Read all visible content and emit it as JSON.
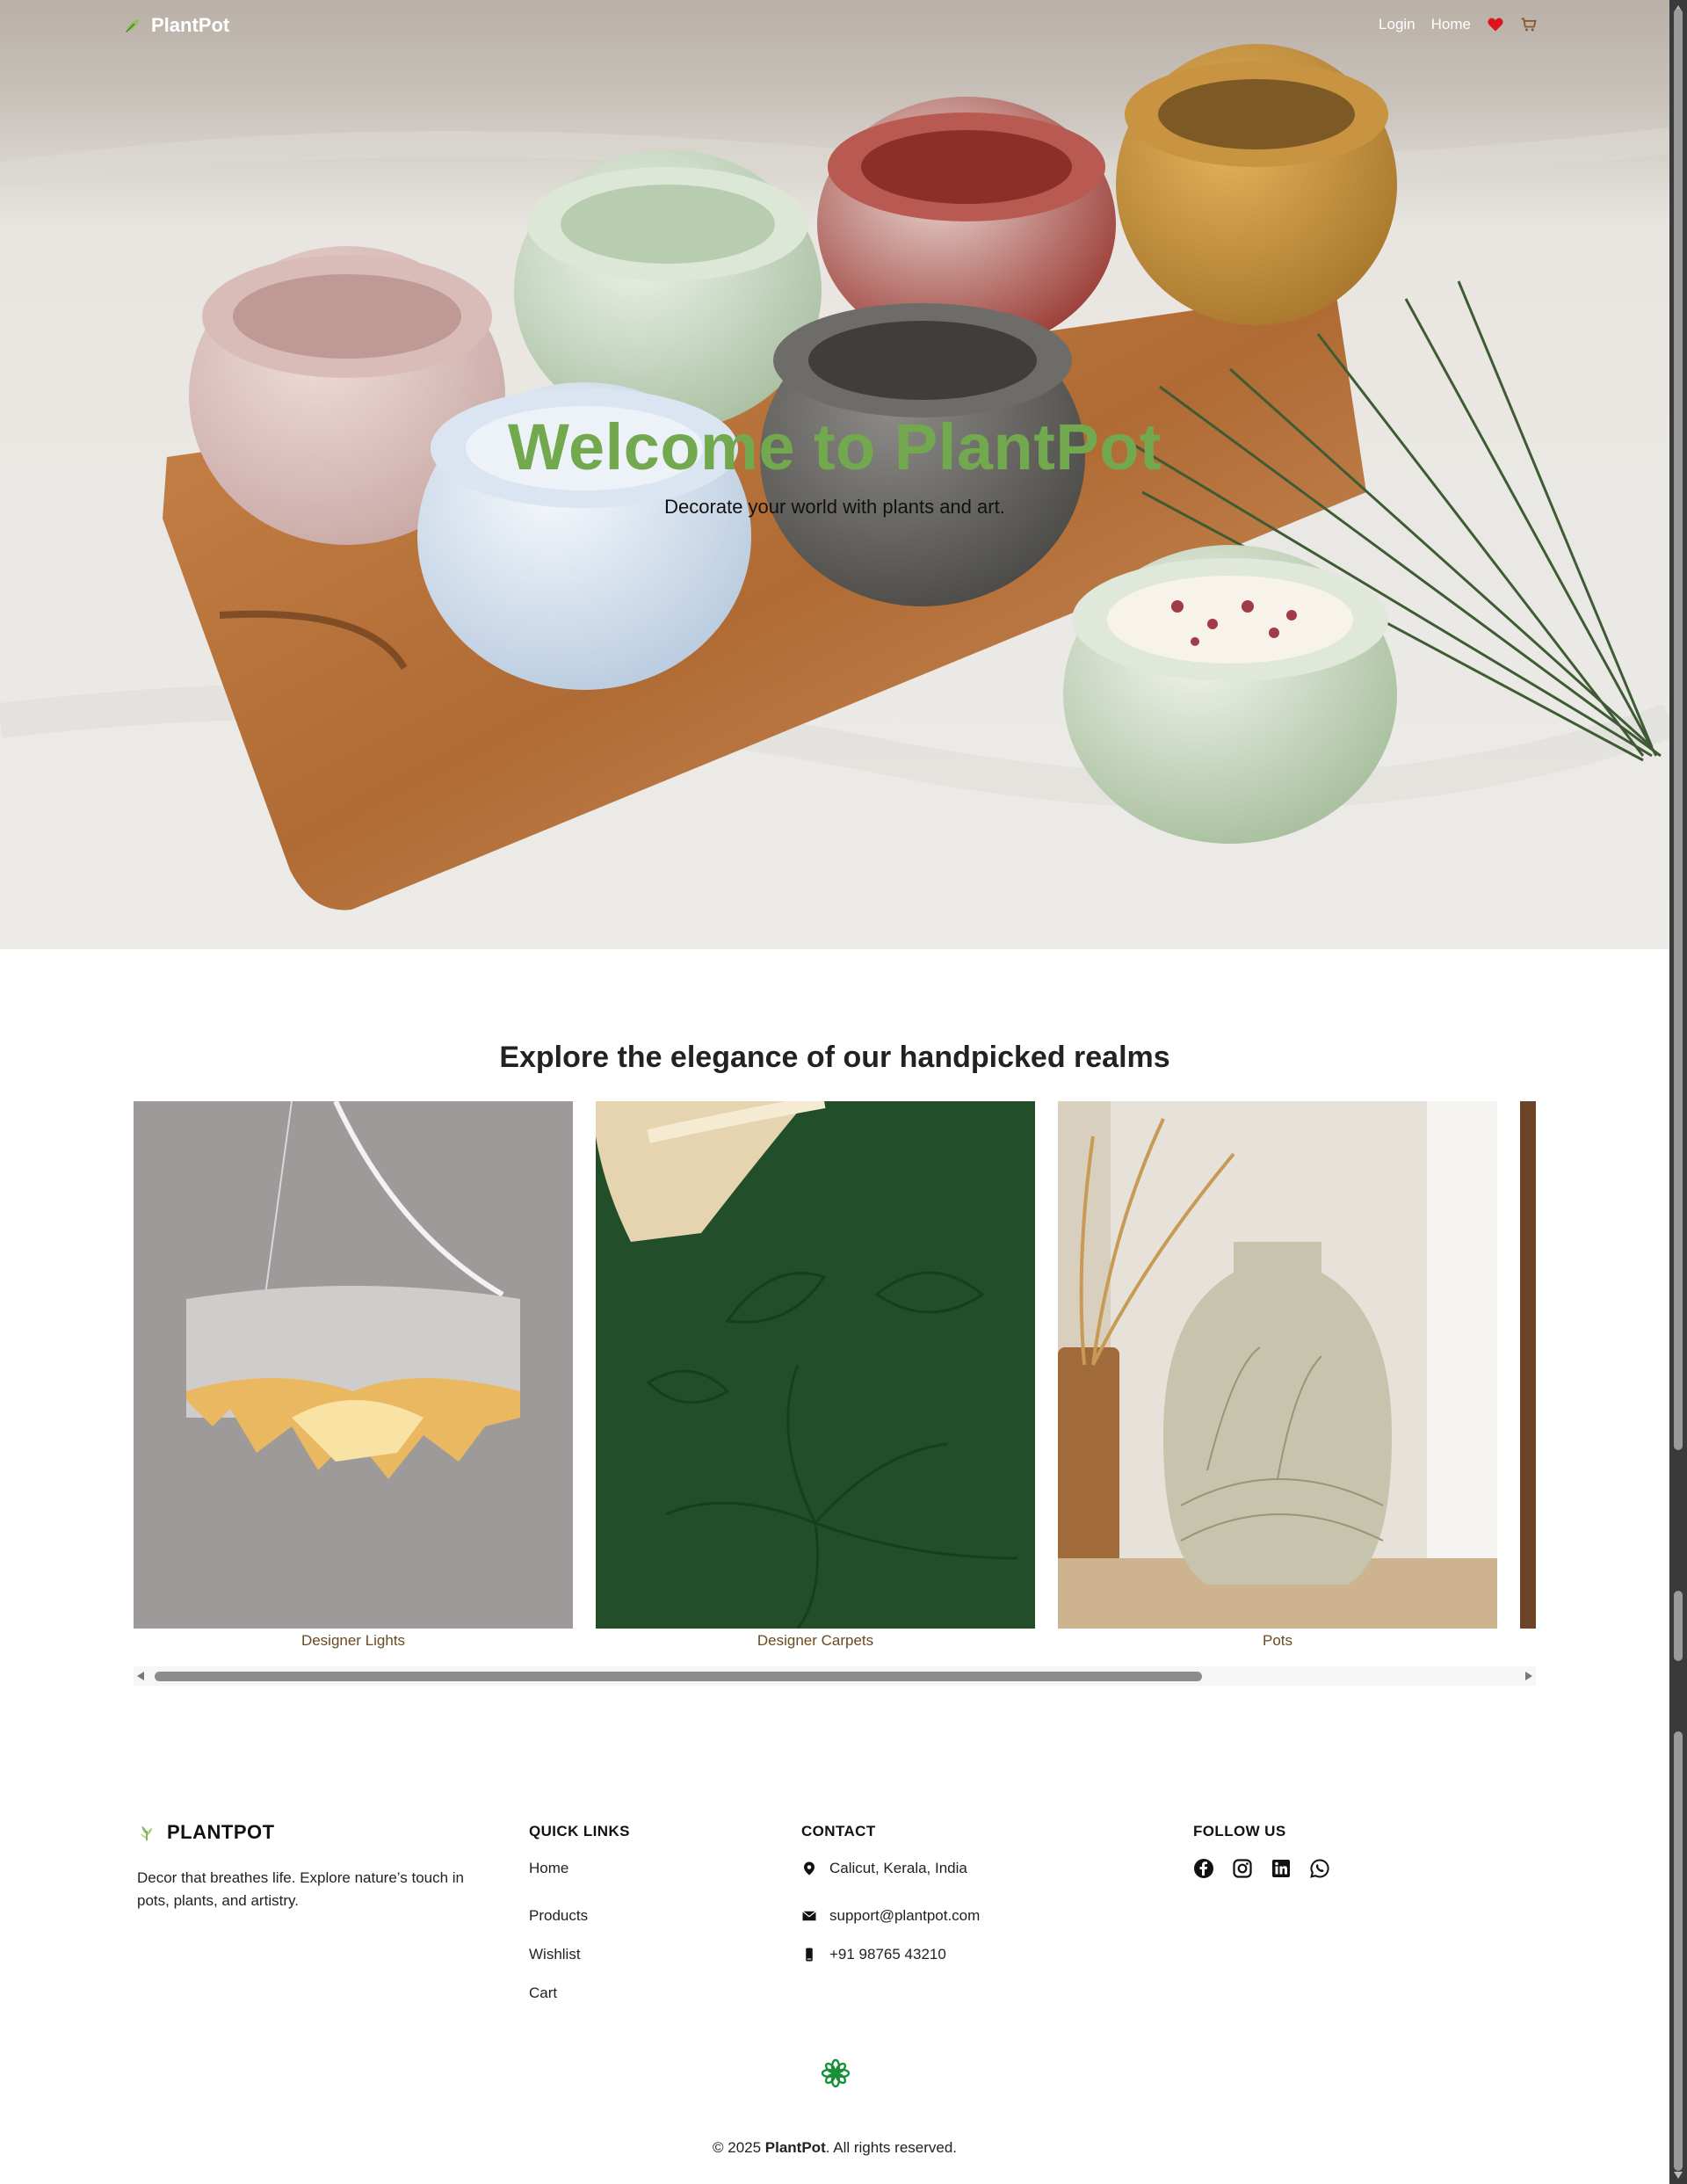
{
  "nav": {
    "brand": "PlantPot",
    "links": [
      "Login",
      "Home"
    ],
    "icons": [
      "heart-icon",
      "cart-icon"
    ],
    "heart_color": "#e0141e",
    "cart_color": "#8b5a2b"
  },
  "hero": {
    "title": "Welcome to PlantPot",
    "subtitle": "Decorate your world with plants and art.",
    "title_color": "#73a94e"
  },
  "realms": {
    "title": "Explore the elegance of our handpicked realms",
    "cards": [
      {
        "label": "Designer Lights"
      },
      {
        "label": "Designer Carpets"
      },
      {
        "label": "Pots"
      },
      {
        "label": ""
      }
    ]
  },
  "footer": {
    "brand": "PLANTPOT",
    "description": "Decor that breathes life. Explore nature’s touch in pots, plants, and artistry.",
    "quick_links": {
      "heading": "QUICK LINKS",
      "items": [
        "Home",
        "Products",
        "Wishlist",
        "Cart"
      ]
    },
    "contact": {
      "heading": "CONTACT",
      "items": [
        {
          "icon": "location-pin-icon",
          "text": "Calicut, Kerala, India"
        },
        {
          "icon": "envelope-icon",
          "text": "support@plantpot.com"
        },
        {
          "icon": "phone-icon",
          "text": "+91 98765 43210"
        }
      ]
    },
    "follow": {
      "heading": "FOLLOW US",
      "icons": [
        "facebook-icon",
        "instagram-icon",
        "linkedin-icon",
        "whatsapp-icon"
      ]
    },
    "copyright_prefix": "© 2025 ",
    "copyright_brand": "PlantPot",
    "copyright_suffix": ". All rights reserved."
  }
}
